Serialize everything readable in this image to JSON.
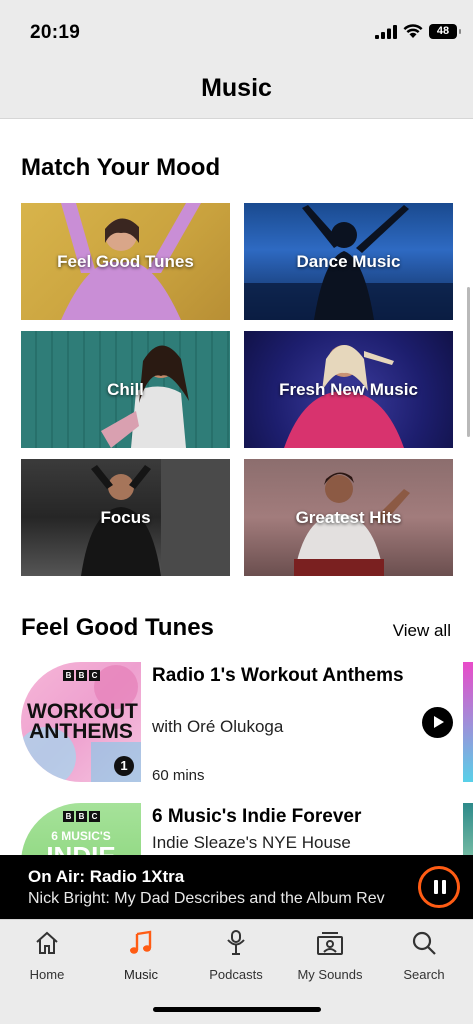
{
  "status_bar": {
    "time": "20:19",
    "battery": "48"
  },
  "header": {
    "title": "Music"
  },
  "mood": {
    "title": "Match Your Mood",
    "tiles": [
      {
        "label": "Feel Good Tunes"
      },
      {
        "label": "Dance Music"
      },
      {
        "label": "Chill"
      },
      {
        "label": "Fresh New Music"
      },
      {
        "label": "Focus"
      },
      {
        "label": "Greatest Hits"
      }
    ]
  },
  "feel_good": {
    "title": "Feel Good Tunes",
    "view_all": "View all",
    "items": [
      {
        "title": "Radio 1's Workout Anthems",
        "subtitle": "with Oré Olukoga",
        "duration": "60 mins",
        "art_text": "WORKOUT ANTHEMS",
        "art_badge": "1",
        "bbc": [
          "B",
          "B",
          "C"
        ]
      },
      {
        "title": "6 Music's Indie Forever",
        "subtitle": "Indie Sleaze's NYE House",
        "art_text": "6 MUSIC'S",
        "art_text2": "INDIE",
        "bbc": [
          "B",
          "B",
          "C"
        ]
      }
    ]
  },
  "now_playing": {
    "on_air": "On Air: Radio 1Xtra",
    "subtitle": "Nick Bright: My Dad Describes and the Album Rev",
    "accent": "#ff5c14"
  },
  "tabs": [
    {
      "label": "Home",
      "icon": "home-icon"
    },
    {
      "label": "Music",
      "icon": "music-note-icon",
      "active": true
    },
    {
      "label": "Podcasts",
      "icon": "podcast-icon"
    },
    {
      "label": "My Sounds",
      "icon": "my-sounds-icon"
    },
    {
      "label": "Search",
      "icon": "search-icon"
    }
  ],
  "colors": {
    "accent": "#ff5c14",
    "background": "#ffffff",
    "bar": "#ebebeb"
  }
}
